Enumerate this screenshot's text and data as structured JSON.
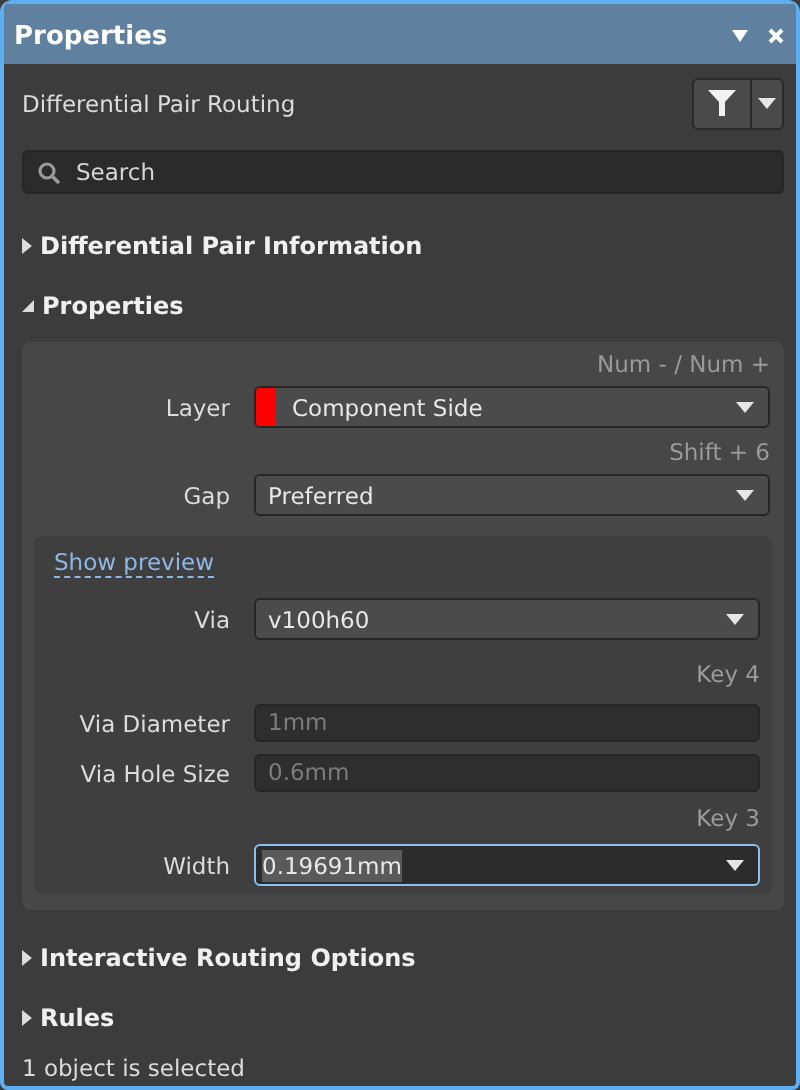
{
  "window": {
    "title": "Properties"
  },
  "header": {
    "title": "Differential Pair Routing"
  },
  "search": {
    "placeholder": "Search"
  },
  "sections": [
    {
      "title": "Differential Pair Information",
      "expanded": false
    },
    {
      "title": "Properties",
      "expanded": true,
      "rows": [
        {
          "kind": "shortcut",
          "text": "Num - / Num +"
        },
        {
          "kind": "combo",
          "label": "Layer",
          "value": "Component Side",
          "color": "#ff0000"
        },
        {
          "kind": "shortcut",
          "text": "Shift + 6"
        },
        {
          "kind": "combo",
          "label": "Gap",
          "value": "Preferred"
        }
      ],
      "subpanel": {
        "link": "Show preview",
        "rows": [
          {
            "kind": "combo",
            "label": "Via",
            "value": "v100h60"
          },
          {
            "kind": "shortcut",
            "text": "Key 4"
          },
          {
            "kind": "text",
            "label": "Via Diameter",
            "value": "1mm",
            "disabled": true
          },
          {
            "kind": "text",
            "label": "Via Hole Size",
            "value": "0.6mm",
            "disabled": true
          },
          {
            "kind": "shortcut",
            "text": "Key 3"
          },
          {
            "kind": "combo",
            "label": "Width",
            "value": "0.19691mm",
            "focused": true
          }
        ]
      }
    },
    {
      "title": "Interactive Routing Options",
      "expanded": false
    },
    {
      "title": "Rules",
      "expanded": false
    }
  ],
  "status_bar": "1 object is selected"
}
